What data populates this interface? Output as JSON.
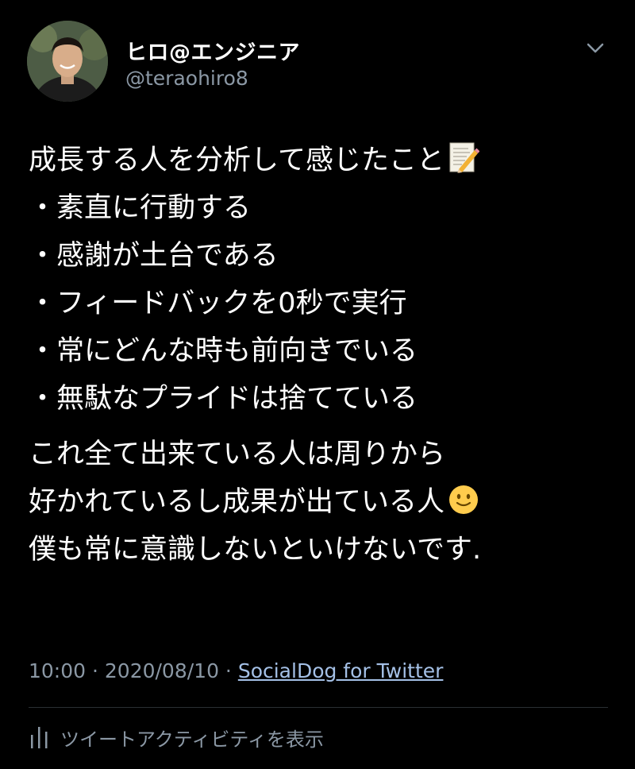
{
  "user": {
    "display_name": "ヒロ@エンジニア",
    "handle": "@teraohiro8"
  },
  "tweet": {
    "heading": "成長する人を分析して感じたこと",
    "heading_emoji": "memo-icon",
    "bullets": [
      "・素直に行動する",
      "・感謝が土台である",
      "・フィードバックを0秒で実行",
      "・常にどんな時も前向きでいる",
      "・無駄なプライドは捨てている"
    ],
    "closing_lines": [
      "これ全て出来ている人は周りから",
      "好かれているし成果が出ている人",
      "僕も常に意識しないといけないです."
    ],
    "closing_emoji": "slightly-smiling-face-icon"
  },
  "meta": {
    "time": "10:00",
    "separator": " · ",
    "date": "2020/08/10",
    "source": "SocialDog for Twitter"
  },
  "activity": {
    "label": "ツイートアクティビティを表示",
    "icon": "analytics-bars-icon"
  },
  "colors": {
    "background": "#000000",
    "text": "#ffffff",
    "secondary_text": "#8b98a5",
    "link": "#a4c0e6",
    "divider": "#2a2f33"
  }
}
